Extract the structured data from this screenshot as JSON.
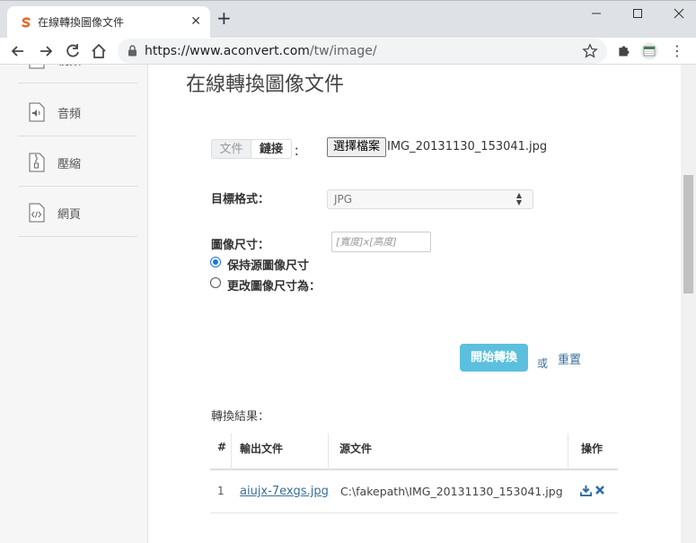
{
  "browser": {
    "tab_title": "在線轉換圖像文件",
    "new_tab": "+",
    "url_host": "https://www.aconvert.com",
    "url_path": "/tw/image/"
  },
  "sidebar": {
    "items": [
      {
        "label": "視頻",
        "icon": "video-file-icon"
      },
      {
        "label": "音頻",
        "icon": "audio-file-icon"
      },
      {
        "label": "壓縮",
        "icon": "archive-file-icon"
      },
      {
        "label": "網頁",
        "icon": "code-file-icon"
      }
    ]
  },
  "main": {
    "title": "在線轉換圖像文件",
    "source_tabs": [
      "文件",
      "鏈接"
    ],
    "colon": "：",
    "file_button": "選擇檔案",
    "file_name": "IMG_20131130_153041.jpg",
    "target_format_label": "目標格式：",
    "target_format_value": "JPG",
    "image_size_label": "圖像尺寸：",
    "size_placeholder": "[寬度]x[高度]",
    "radio_keep": "保持源圖像尺寸",
    "radio_change": "更改圖像尺寸為：",
    "start_button": "開始轉換",
    "or_text": "或",
    "reset_link": "重置",
    "results_label": "轉換結果："
  },
  "results_table": {
    "headers": [
      "#",
      "輸出文件",
      "源文件",
      "操作"
    ],
    "rows": [
      {
        "index": "1",
        "output": "aiujx-7exgs.jpg",
        "source": "C:\\fakepath\\IMG_20131130_153041.jpg"
      }
    ]
  },
  "colors": {
    "accent": "#5bc0de",
    "link": "#3a6f9a",
    "radio": "#1a73e8"
  }
}
